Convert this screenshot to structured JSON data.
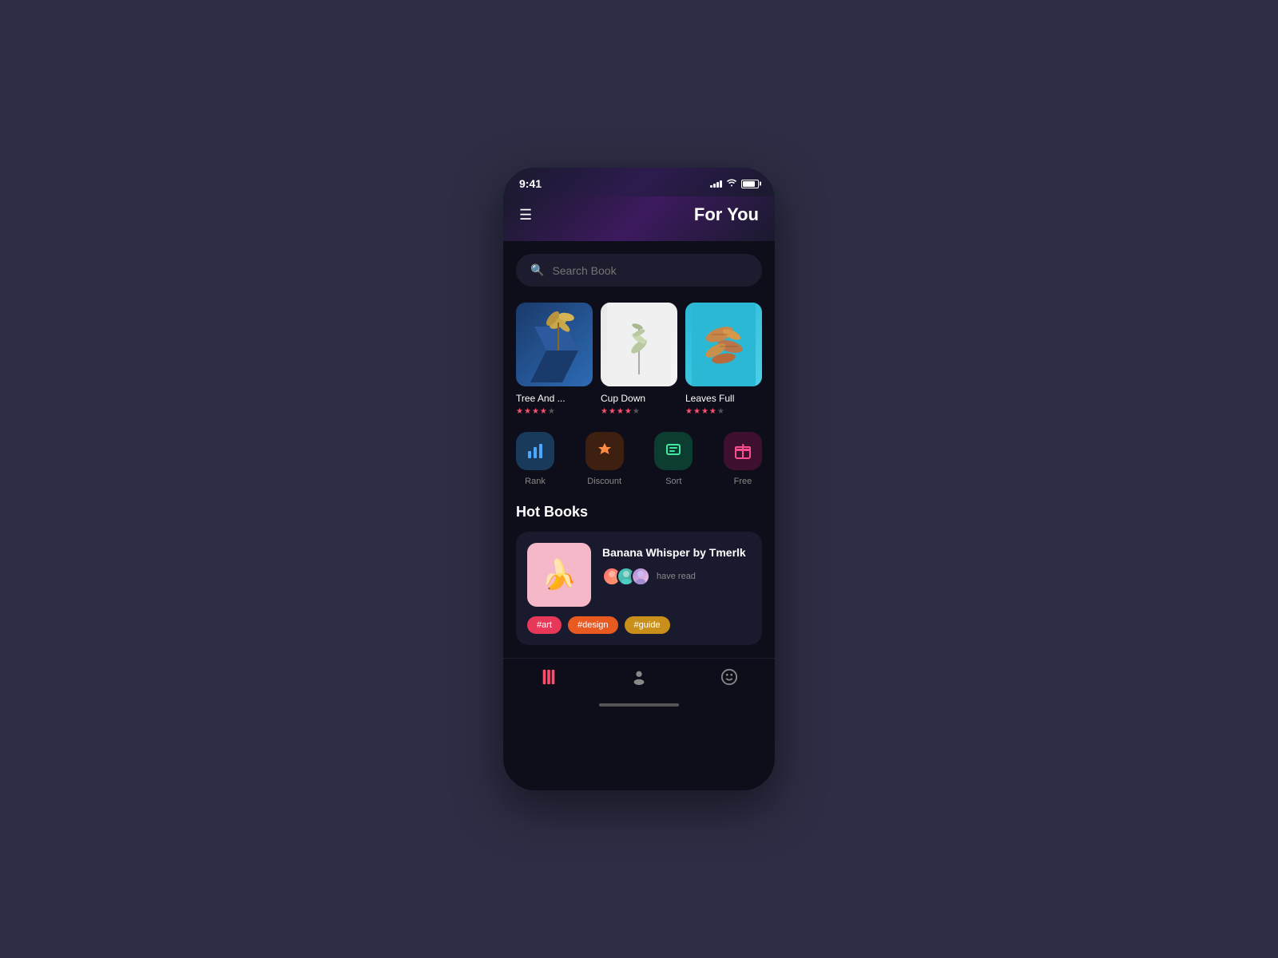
{
  "statusBar": {
    "time": "9:41",
    "signalBars": [
      3,
      5,
      7,
      9,
      11
    ],
    "wifi": "wifi",
    "battery": 85
  },
  "header": {
    "title": "For You",
    "menuLabel": "☰"
  },
  "search": {
    "placeholder": "Search Book"
  },
  "books": [
    {
      "id": "book-1",
      "title": "Tree And ...",
      "stars": [
        1,
        1,
        1,
        1,
        0
      ],
      "coverType": "plant-blue"
    },
    {
      "id": "book-2",
      "title": "Cup Down",
      "stars": [
        1,
        1,
        1,
        1,
        0
      ],
      "coverType": "stem-white"
    },
    {
      "id": "book-3",
      "title": "Leaves Full",
      "stars": [
        1,
        1,
        1,
        1,
        0
      ],
      "coverType": "leaves-teal"
    }
  ],
  "categories": [
    {
      "id": "rank",
      "label": "Rank",
      "icon": "📊",
      "colorClass": "cat-rank"
    },
    {
      "id": "discount",
      "label": "Discount",
      "icon": "🏷️",
      "colorClass": "cat-discount"
    },
    {
      "id": "sort",
      "label": "Sort",
      "icon": "📦",
      "colorClass": "cat-sort"
    },
    {
      "id": "free",
      "label": "Free",
      "icon": "🎁",
      "colorClass": "cat-free"
    }
  ],
  "hotBooks": {
    "sectionTitle": "Hot Books",
    "book": {
      "title": "Banana Whisper by Tmerlk",
      "haveReadText": "have read",
      "tags": [
        "#art",
        "#design",
        "#guide"
      ]
    }
  },
  "bottomNav": [
    {
      "id": "nav-books",
      "icon": "📚",
      "active": true
    },
    {
      "id": "nav-user",
      "icon": "👤",
      "active": false
    },
    {
      "id": "nav-profile",
      "icon": "😊",
      "active": false
    }
  ]
}
